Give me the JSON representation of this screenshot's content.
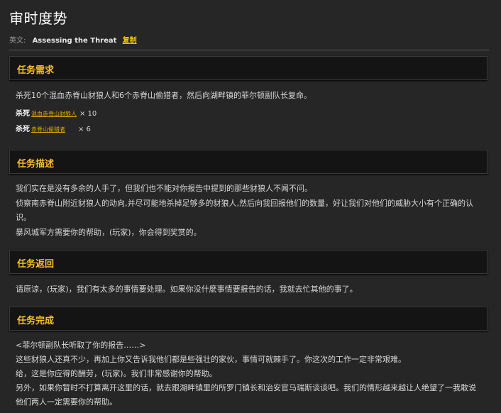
{
  "quest": {
    "title": "审时度势",
    "english_label": "英文:",
    "english_title": "Assessing the Threat",
    "copy_label": "复制"
  },
  "sections": {
    "requirements": {
      "heading": "任务需求",
      "text": "杀死10个混血赤脊山豺狼人和6个赤脊山偷猎者，然后向湖畔镇的菲尔顿副队长复命。",
      "kills": [
        {
          "label": "杀死",
          "mob": "混血赤脊山豺狼人",
          "count": "× 10"
        },
        {
          "label": "杀死",
          "mob": "赤脊山偷猎者",
          "count": "× 6"
        }
      ]
    },
    "description": {
      "heading": "任务描述",
      "lines": [
        "我们实在是没有多余的人手了，但我们也不能对你报告中提到的那些豺狼人不闻不问。",
        "侦察南赤脊山附近豺狼人的动向,并尽可能地杀掉足够多的豺狼人,然后向我回报他们的数量，好让我们对他们的威胁大小有个正确的认",
        "识。",
        "暴风城军方需要你的帮助，(玩家)，你会得到奖赏的。"
      ]
    },
    "return": {
      "heading": "任务返回",
      "text": "请原谅，(玩家)，我们有太多的事情要处理。如果你没什麼事情要报告的话，我就去忙其他的事了。"
    },
    "completion": {
      "heading": "任务完成",
      "lines": [
        "<菲尔顿副队长听取了你的报告……>",
        "这些豺狼人还真不少，再加上你又告诉我他们都是些强壮的家伙，事情可就棘手了。你这次的工作一定非常艰难。",
        "给，这是你应得的酬劳，(玩家)。我们非常感谢你的帮助。",
        "另外，如果你暂时不打算离开这里的话，就去跟湖畔镇里的所罗门镇长和治安官马瑞斯谈谈吧。我们的情形越来越让人绝望了一我敢说",
        "他们两人一定需要你的帮助。"
      ]
    }
  }
}
